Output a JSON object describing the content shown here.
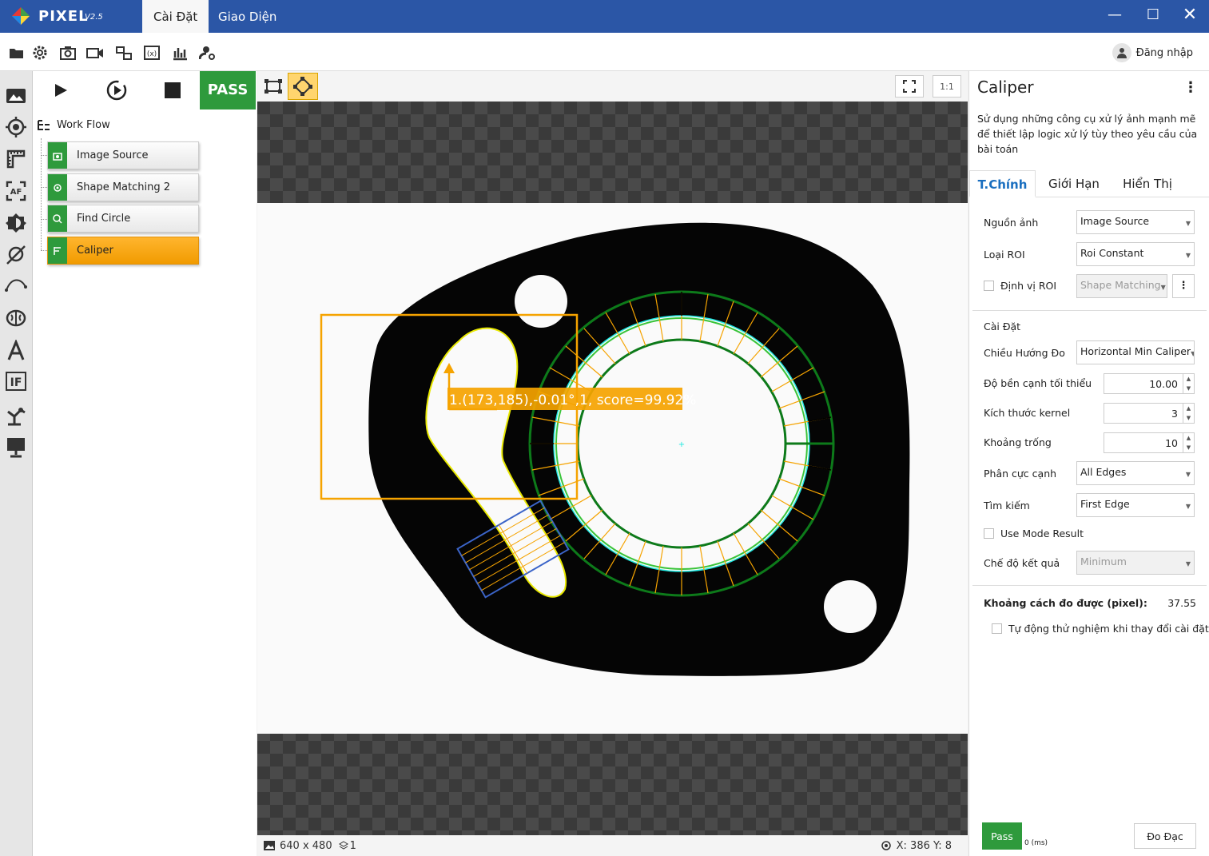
{
  "app": {
    "name": "PIXEL",
    "version": "V2.5"
  },
  "title_tabs": [
    "Cài Đặt",
    "Giao Diện"
  ],
  "toolbar": {
    "icons": [
      "folder-icon",
      "settings-icon",
      "camera-icon",
      "video-icon",
      "io-icon",
      "variable-icon",
      "chart-icon",
      "user-settings-icon"
    ],
    "login_label": "Đăng nhập"
  },
  "leftbar_icons": [
    "image-icon",
    "target-icon",
    "ruler-icon",
    "autofocus-icon",
    "brightness-icon",
    "measure-icon",
    "curve-icon",
    "brain-icon",
    "text-icon",
    "if-icon",
    "robot-icon",
    "display-icon"
  ],
  "workflow": {
    "pass_label": "PASS",
    "title": "Work Flow",
    "nodes": [
      {
        "label": "Image Source",
        "selected": false
      },
      {
        "label": "Shape Matching 2",
        "selected": false
      },
      {
        "label": "Find Circle",
        "selected": false
      },
      {
        "label": "Caliper",
        "selected": true
      }
    ]
  },
  "viewer": {
    "ratio_label": "1:1",
    "overlay_text": "1.(173,185),-0.01°,1, score=99.92%",
    "image_size": "640 x 480",
    "layer_count": "1",
    "cursor": "X: 386 Y: 8",
    "colors": {
      "roi": "#f5a300",
      "circle": "#0d7a1a",
      "edge": "#1fe8e0",
      "caliper": "#3b64c8"
    }
  },
  "panel": {
    "title": "Caliper",
    "description": "Sử dụng những công cụ xử lý ảnh mạnh mẽ để thiết lập logic xử lý tùy theo yêu cầu của bài toán",
    "tabs": [
      "T.Chính",
      "Giới Hạn",
      "Hiển Thị"
    ],
    "source_label": "Nguồn ảnh",
    "source_value": "Image Source",
    "roi_type_label": "Loại ROI",
    "roi_type_value": "Roi Constant",
    "roi_locate_label": "Định vị ROI",
    "roi_locate_value": "Shape Matching",
    "settings_header": "Cài Đặt",
    "direction_label": "Chiều Hướng Đo",
    "direction_value": "Horizontal Min Caliper",
    "min_edge_label": "Độ bền cạnh tối thiểu",
    "min_edge_value": "10.00",
    "kernel_label": "Kích thước kernel",
    "kernel_value": "3",
    "gap_label": "Khoảng trống",
    "gap_value": "10",
    "polarity_label": "Phân cực cạnh",
    "polarity_value": "All Edges",
    "search_label": "Tìm kiếm",
    "search_value": "First Edge",
    "mode_result_label": "Use Mode Result",
    "result_mode_label": "Chế độ kết quả",
    "result_mode_value": "Minimum",
    "distance_label": "Khoảng cách đo được (pixel):",
    "distance_value": "37.55",
    "auto_test_label": "Tự động thử nghiệm khi thay đổi cài đặt",
    "pass_label": "Pass",
    "time_label": "0 (ms)",
    "measure_button": "Đo Đạc"
  }
}
